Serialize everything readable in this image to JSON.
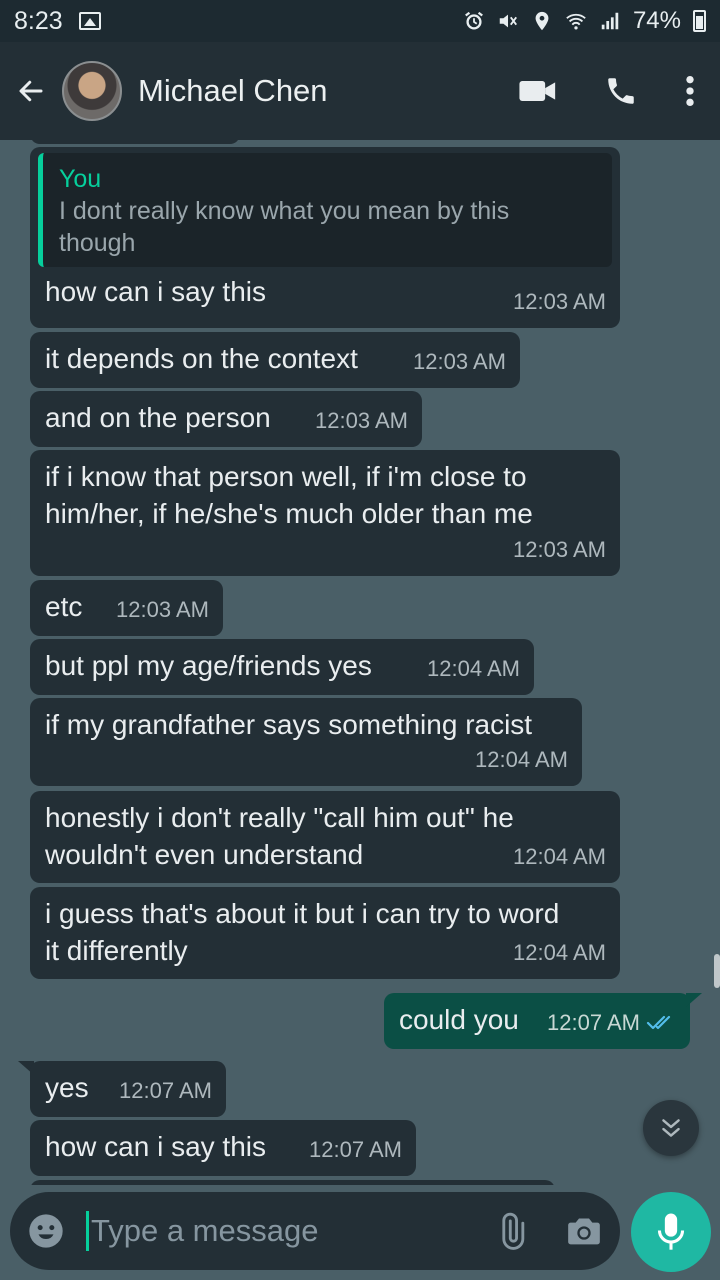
{
  "status_bar": {
    "time": "8:23",
    "battery": "74%",
    "icons": [
      "gallery-icon",
      "alarm-icon",
      "mute-icon",
      "location-icon",
      "wifi-icon",
      "signal-icon",
      "battery-icon"
    ]
  },
  "header": {
    "contact_name": "Michael Chen",
    "icons": [
      "back-arrow-icon",
      "video-call-icon",
      "voice-call-icon",
      "more-options-icon"
    ]
  },
  "messages": [
    {
      "direction": "in",
      "quote": {
        "author": "You",
        "text": "I dont really know what you mean by this\nthough"
      },
      "text": "how can i say this",
      "time": "12:03 AM"
    },
    {
      "direction": "in",
      "text": "it depends on the context",
      "time": "12:03 AM"
    },
    {
      "direction": "in",
      "text": "and on the person",
      "time": "12:03 AM"
    },
    {
      "direction": "in",
      "text": "if i know that person well, if i'm close to\nhim/her, if he/she's much older than me",
      "time": "12:03 AM"
    },
    {
      "direction": "in",
      "text": "etc",
      "time": "12:03 AM"
    },
    {
      "direction": "in",
      "text": "but ppl my age/friends yes",
      "time": "12:04 AM"
    },
    {
      "direction": "in",
      "text": "if my grandfather says something racist",
      "time": "12:04 AM"
    },
    {
      "direction": "in",
      "text": "honestly i don't really \"call him out\" he\nwouldn't even understand",
      "time": "12:04 AM"
    },
    {
      "direction": "in",
      "text": "i guess that's about it but i can try to word\nit differently",
      "time": "12:04 AM"
    },
    {
      "direction": "out",
      "text": "could you",
      "time": "12:07 AM",
      "status": "read"
    },
    {
      "direction": "in",
      "text": "yes",
      "time": "12:07 AM"
    },
    {
      "direction": "in",
      "text": "how can i say this",
      "time": "12:07 AM"
    }
  ],
  "composer": {
    "placeholder": "Type a message",
    "icons": [
      "emoji-icon",
      "attach-icon",
      "camera-icon",
      "mic-icon"
    ]
  },
  "colors": {
    "chat_background": "#4a5f67",
    "incoming_bubble": "#232f36",
    "outgoing_bubble": "#0b4f45",
    "accent": "#06cf9c",
    "mic_button": "#1fb8a3",
    "read_ticks": "#53bdeb"
  }
}
